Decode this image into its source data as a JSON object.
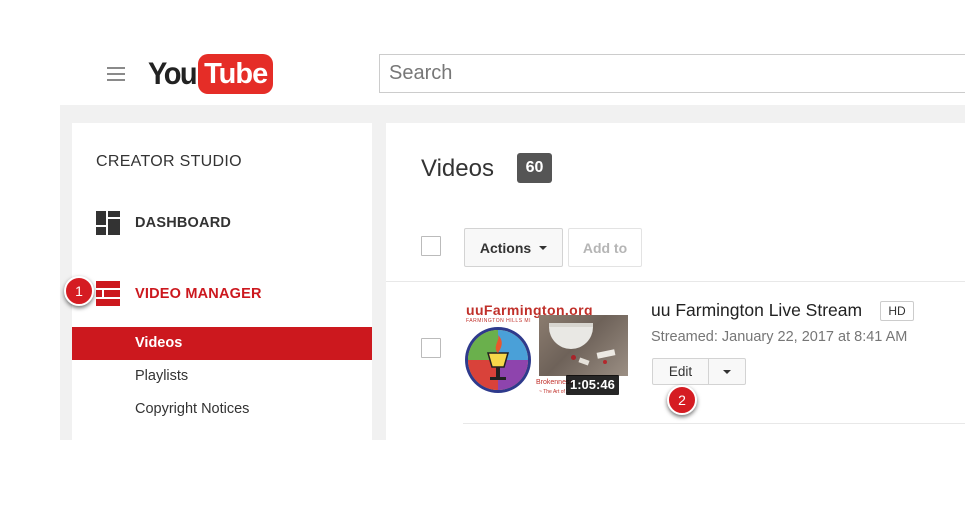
{
  "header": {
    "logo_you": "You",
    "logo_tube": "Tube",
    "search_placeholder": "Search"
  },
  "sidebar": {
    "title": "CREATOR STUDIO",
    "dashboard_label": "DASHBOARD",
    "video_manager_label": "VIDEO MANAGER",
    "sub_items": [
      "Videos",
      "Playlists",
      "Copyright Notices"
    ]
  },
  "main": {
    "title": "Videos",
    "count": "60",
    "actions_label": "Actions",
    "add_to_label": "Add to"
  },
  "video": {
    "title": "uu Farmington Live Stream",
    "quality_badge": "HD",
    "streamed": "Streamed: January 22, 2017 at 8:41 AM",
    "edit_label": "Edit",
    "duration": "1:05:46",
    "thumb_heading": "uuFarmington.org",
    "thumb_subheading": "FARMINGTON HILLS MI",
    "thumb_caption": "Brokenness",
    "thumb_caption_sub": "~ The Art of ..."
  },
  "markers": [
    "1",
    "2"
  ],
  "colors": {
    "brand_red": "#cc181e",
    "logo_red": "#e52d27",
    "badge_grey": "#555555"
  }
}
